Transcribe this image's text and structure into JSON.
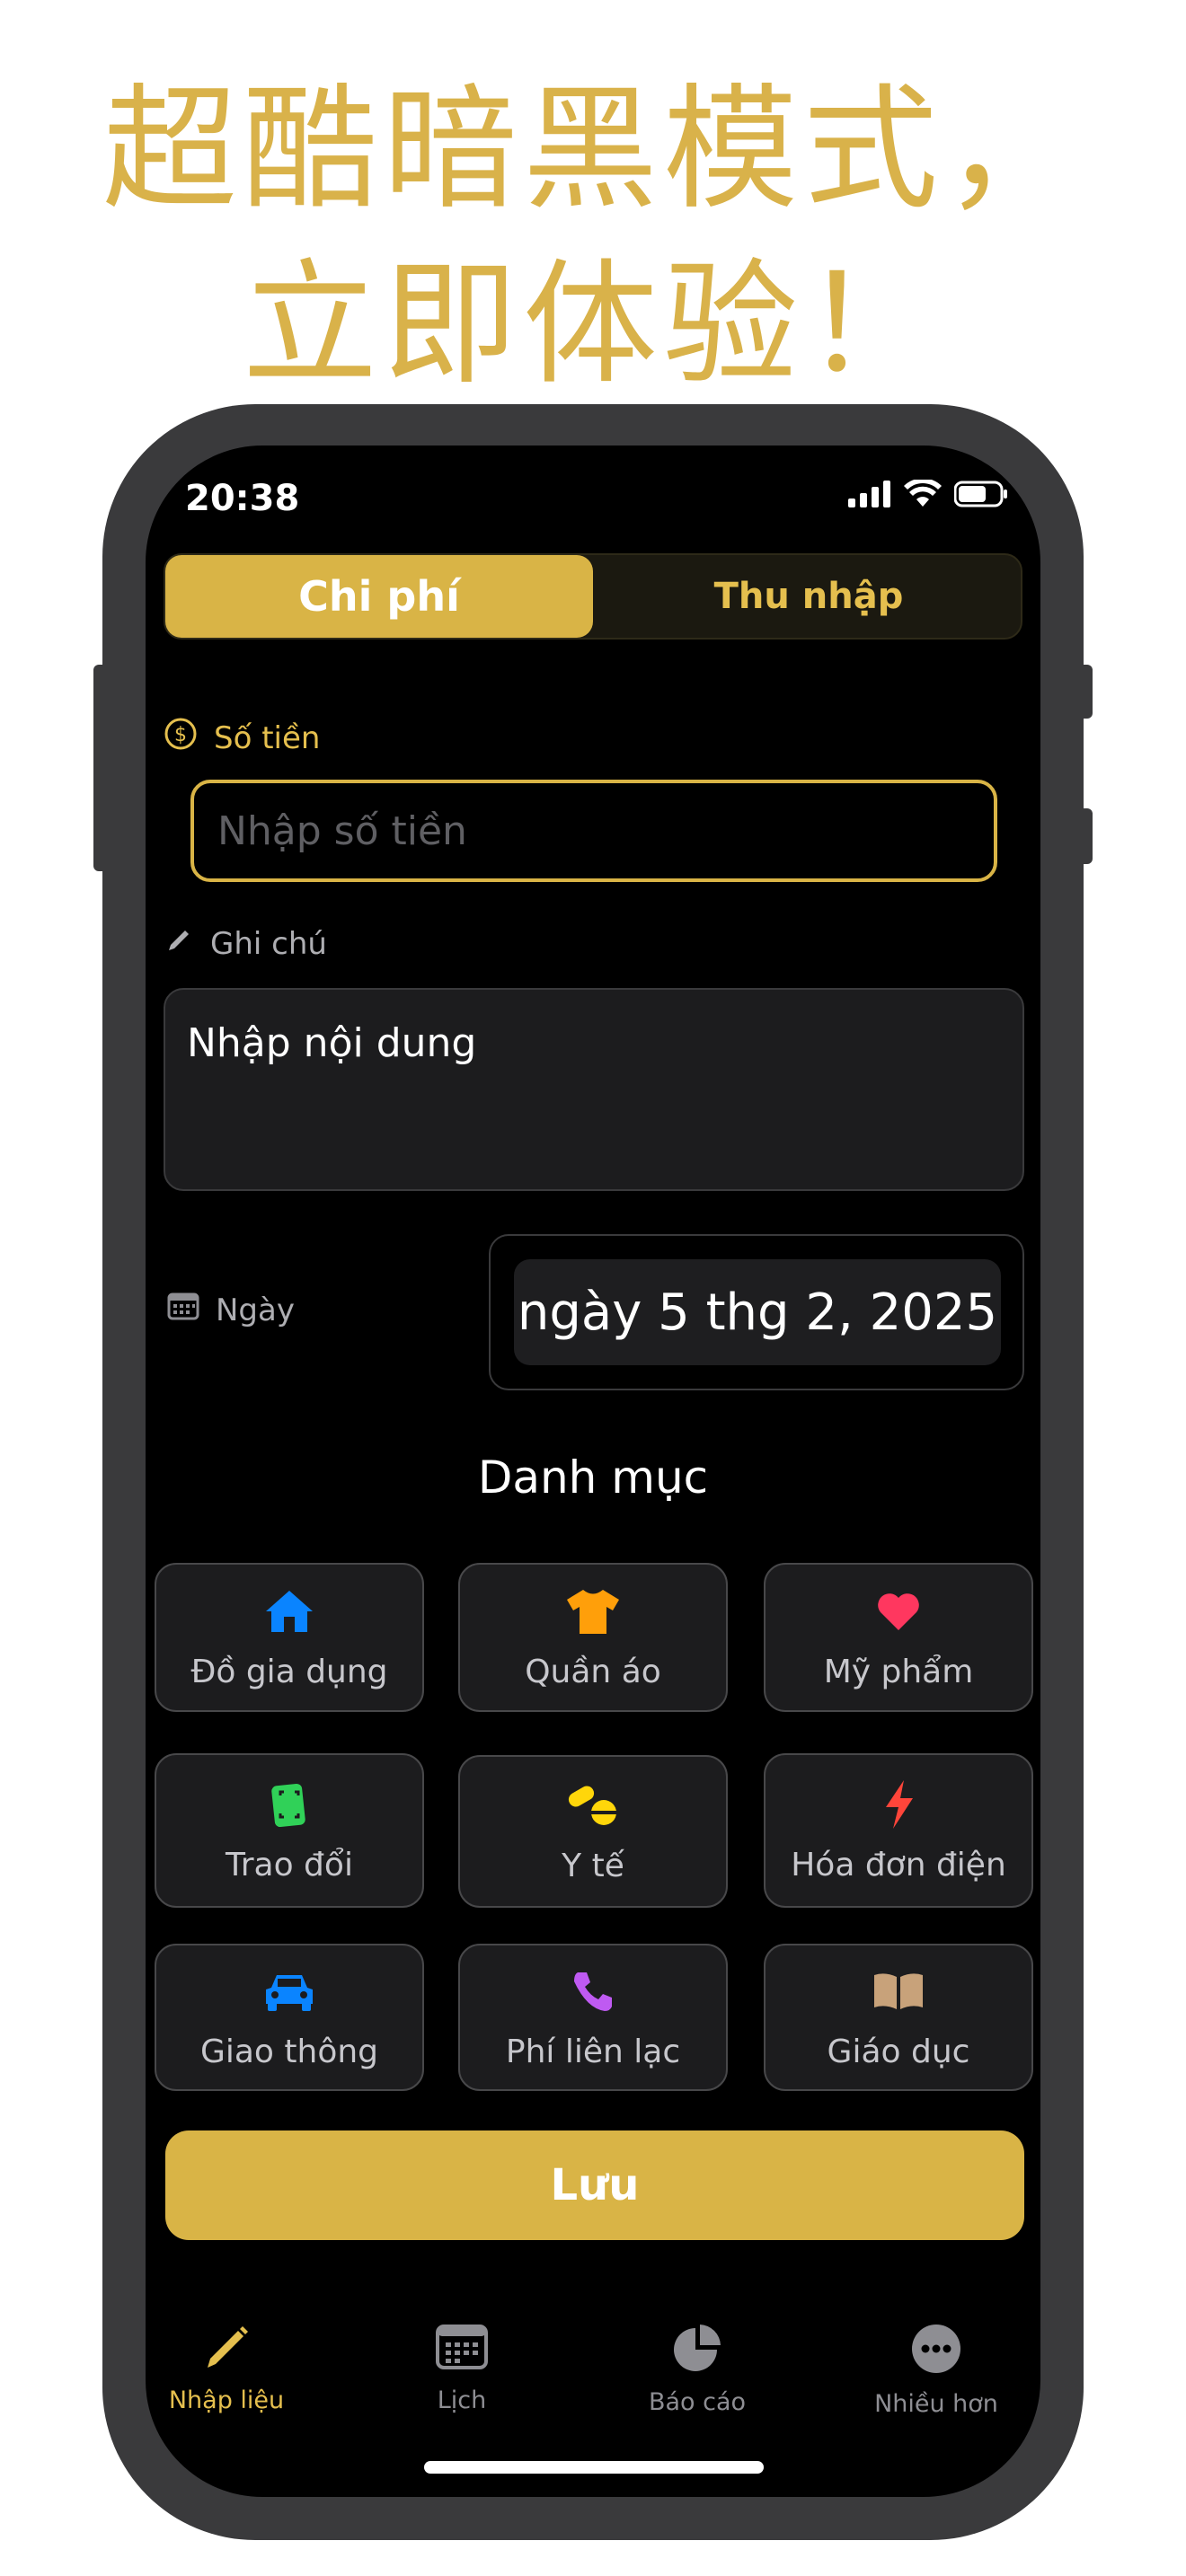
{
  "headline": {
    "line1": "超酷暗黑模式，",
    "line2": "立即体验！"
  },
  "status_bar": {
    "time": "20:38"
  },
  "segment": {
    "expense_label": "Chi phí",
    "income_label": "Thu nhập",
    "selected": "Chi phí"
  },
  "amount": {
    "label": "Số tiền",
    "placeholder": "Nhập số tiền"
  },
  "note": {
    "label": "Ghi chú",
    "placeholder": "Nhập nội dung"
  },
  "date": {
    "label": "Ngày",
    "value": "ngày 5 thg 2, 2025"
  },
  "categories": {
    "title": "Danh mục",
    "items": [
      {
        "label": "Đồ gia dụng",
        "icon": "house-icon",
        "color": "#0a84ff"
      },
      {
        "label": "Quần áo",
        "icon": "tshirt-icon",
        "color": "#ff9f0a"
      },
      {
        "label": "Mỹ phẩm",
        "icon": "heart-icon",
        "color": "#ff375f"
      },
      {
        "label": "Trao đổi",
        "icon": "exchange-icon",
        "color": "#30d158"
      },
      {
        "label": "Y tế",
        "icon": "pills-icon",
        "color": "#ffd60a"
      },
      {
        "label": "Hóa đơn điện",
        "icon": "bolt-icon",
        "color": "#ff453a"
      },
      {
        "label": "Giao thông",
        "icon": "car-icon",
        "color": "#0a84ff"
      },
      {
        "label": "Phí liên lạc",
        "icon": "phone-icon",
        "color": "#bf5af2"
      },
      {
        "label": "Giáo dục",
        "icon": "book-icon",
        "color": "#c8a27a"
      }
    ]
  },
  "save_button": {
    "label": "Lưu"
  },
  "tab_bar": {
    "items": [
      {
        "label": "Nhập liệu",
        "icon": "pencil-icon",
        "active": true
      },
      {
        "label": "Lịch",
        "icon": "calendar-icon",
        "active": false
      },
      {
        "label": "Báo cáo",
        "icon": "pie-chart-icon",
        "active": false
      },
      {
        "label": "Nhiều hơn",
        "icon": "more-icon",
        "active": false
      }
    ]
  },
  "colors": {
    "accent": "#d9b446",
    "background": "#000000",
    "card": "#1c1c1e",
    "headline": "#d9b24a"
  }
}
